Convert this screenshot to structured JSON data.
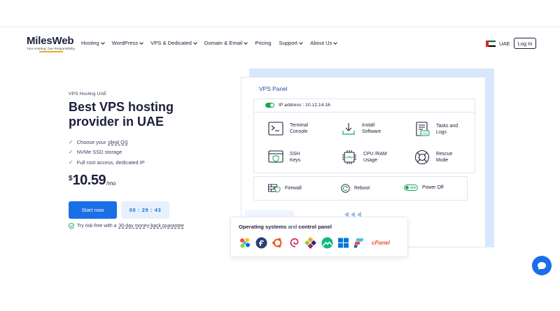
{
  "brand": {
    "name": "MilesWeb",
    "tagline": "Your Hosting, Our Responsibility"
  },
  "nav": {
    "items": [
      {
        "label": "Hosting",
        "has_dropdown": true
      },
      {
        "label": "WordPress",
        "has_dropdown": true
      },
      {
        "label": "VPS & Dedicated",
        "has_dropdown": true
      },
      {
        "label": "Domain & Email",
        "has_dropdown": true
      },
      {
        "label": "Pricing",
        "has_dropdown": false
      },
      {
        "label": "Support",
        "has_dropdown": true
      },
      {
        "label": "About Us",
        "has_dropdown": true
      }
    ],
    "region": "UAE",
    "login_label": "Log In"
  },
  "hero": {
    "eyebrow": "VPS Hosting UAE",
    "title": "Best VPS hosting provider in UAE",
    "features": [
      {
        "text": "Choose your",
        "link": "ideal OS"
      },
      {
        "text": "NVMe SSD storage",
        "link": ""
      },
      {
        "text": "Full root access, dedicated IP",
        "link": ""
      }
    ],
    "price": {
      "currency": "$",
      "amount": "10.59",
      "period": "/mo"
    },
    "cta_label": "Start now",
    "timer": "00 : 29 : 43",
    "guarantee_text": "Try risk-free with a",
    "guarantee_link": "30-day money-back guarantee"
  },
  "panel": {
    "title": "VPS Panel",
    "ip_label": "IP address : 10.12.14.16",
    "tiles": [
      {
        "label": "Terminal\nConsole",
        "icon": "terminal-icon"
      },
      {
        "label": "Install\nSoftware",
        "icon": "download-icon"
      },
      {
        "label": "Tasks and\nLogs",
        "icon": "logs-icon"
      },
      {
        "label": "SSH\nKeys",
        "icon": "ssh-key-icon"
      },
      {
        "label": "CPU /RAM\nUsage",
        "icon": "cpu-icon"
      },
      {
        "label": "Rescue\nMode",
        "icon": "lifebuoy-icon"
      }
    ],
    "actions": [
      {
        "label": "Firewall",
        "icon": "firewall-icon"
      },
      {
        "label": "Reboot",
        "icon": "reboot-icon"
      },
      {
        "label": "Power Off",
        "icon": "power-toggle",
        "toggle_text": "OFF"
      }
    ]
  },
  "os_card": {
    "title_bold": "Operating systems",
    "title_rest": " and ",
    "title_bold2": "control panel",
    "icons": [
      "almalinux-icon",
      "fedora-icon",
      "ubuntu-icon",
      "debian-icon",
      "centos-icon",
      "rocky-linux-icon",
      "windows-icon",
      "plesk-icon",
      "cpanel-logo"
    ],
    "cpanel_text": "cPanel"
  },
  "colors": {
    "primary": "#1a6fe8",
    "success": "#1aa35a",
    "text": "#1b1f3b",
    "panel_shadow": "#d7e8fc"
  }
}
